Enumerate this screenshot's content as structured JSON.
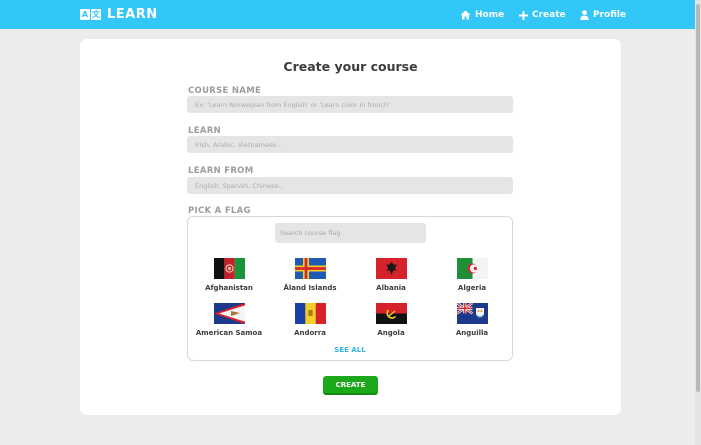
{
  "navbar": {
    "logo_glyphs": [
      "A",
      "文"
    ],
    "logo_text": "LEARN",
    "home_label": "Home",
    "create_label": "Create",
    "profile_label": "Profile",
    "icons": [
      "home-icon",
      "plus-icon",
      "user-icon"
    ],
    "background_color": "#32c7f6"
  },
  "form": {
    "title": "Create your course",
    "course_name": {
      "label": "COURSE NAME",
      "placeholder": "Ex: 'Learn Norwegian from English' or 'Learn color in french'",
      "value": ""
    },
    "learn": {
      "label": "LEARN",
      "placeholder": "Irish, Arabic, Vietnamese...",
      "value": ""
    },
    "learn_from": {
      "label": "LEARN FROM",
      "placeholder": "English, Spanish, Chinese...",
      "value": ""
    },
    "flag_picker": {
      "label": "PICK A FLAG",
      "search_placeholder": "Search course flag",
      "flags": [
        {
          "name": "Afghanistan",
          "icon": "afghanistan-flag-icon"
        },
        {
          "name": "Åland Islands",
          "icon": "aland-islands-flag-icon"
        },
        {
          "name": "Albania",
          "icon": "albania-flag-icon"
        },
        {
          "name": "Algeria",
          "icon": "algeria-flag-icon"
        },
        {
          "name": "American Samoa",
          "icon": "american-samoa-flag-icon"
        },
        {
          "name": "Andorra",
          "icon": "andorra-flag-icon"
        },
        {
          "name": "Angola",
          "icon": "angola-flag-icon"
        },
        {
          "name": "Anguilla",
          "icon": "anguilla-flag-icon"
        }
      ],
      "see_all_label": "SEE ALL"
    },
    "create_button_label": "CREATE",
    "accent_color": "#1ba81b"
  }
}
